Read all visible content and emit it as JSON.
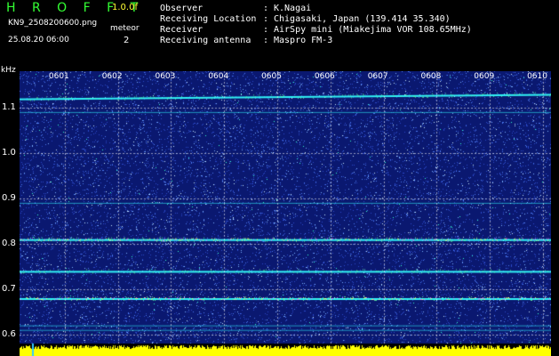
{
  "header": {
    "brand": "H R O F F T",
    "version": "1.0.0f",
    "filename": "KN9_2508200600.png",
    "mode": "meteor",
    "datetime": "25.08.20 06:00",
    "count": "2",
    "meta": [
      {
        "label": "Observer",
        "colon": ":",
        "value": "K.Nagai"
      },
      {
        "label": "Receiving Location",
        "colon": ":",
        "value": "Chigasaki, Japan (139.414 35.340)"
      },
      {
        "label": "Receiver",
        "colon": ":",
        "value": "AirSpy mini (Miakejima VOR 108.65MHz)"
      },
      {
        "label": "Receiving antenna",
        "colon": ":",
        "value": "Maspro FM-3"
      }
    ]
  },
  "colors": {
    "brand": "#33ff33",
    "version": "#ffff33",
    "background": "#0a1870",
    "signal": "#33ffff",
    "strong_signal": "#ff66ff",
    "amplitude": "#ffff00"
  },
  "chart_data": {
    "type": "heatmap",
    "unit": "kHz",
    "x_ticks": [
      "0601",
      "0602",
      "0603",
      "0604",
      "0605",
      "0606",
      "0607",
      "0608",
      "0609",
      "0610"
    ],
    "y_ticks": [
      "1.1",
      "1.0",
      "0.9",
      "0.8",
      "0.7",
      "0.6"
    ],
    "y_tick_values": [
      1.1,
      1.0,
      0.9,
      0.8,
      0.7,
      0.6
    ],
    "ylim": [
      0.58,
      1.18
    ],
    "signal_lines": [
      {
        "start": 1.12,
        "end": 1.13,
        "strength": "medium"
      },
      {
        "start": 1.09,
        "end": 1.09,
        "strength": "weak"
      },
      {
        "start": 0.89,
        "end": 0.89,
        "strength": "weak"
      },
      {
        "start": 0.81,
        "end": 0.81,
        "strength": "strong"
      },
      {
        "start": 0.74,
        "end": 0.74,
        "strength": "medium"
      },
      {
        "start": 0.68,
        "end": 0.68,
        "strength": "strong"
      },
      {
        "start": 0.62,
        "end": 0.62,
        "strength": "weak"
      },
      {
        "start": 0.61,
        "end": 0.61,
        "strength": "weak"
      }
    ]
  }
}
